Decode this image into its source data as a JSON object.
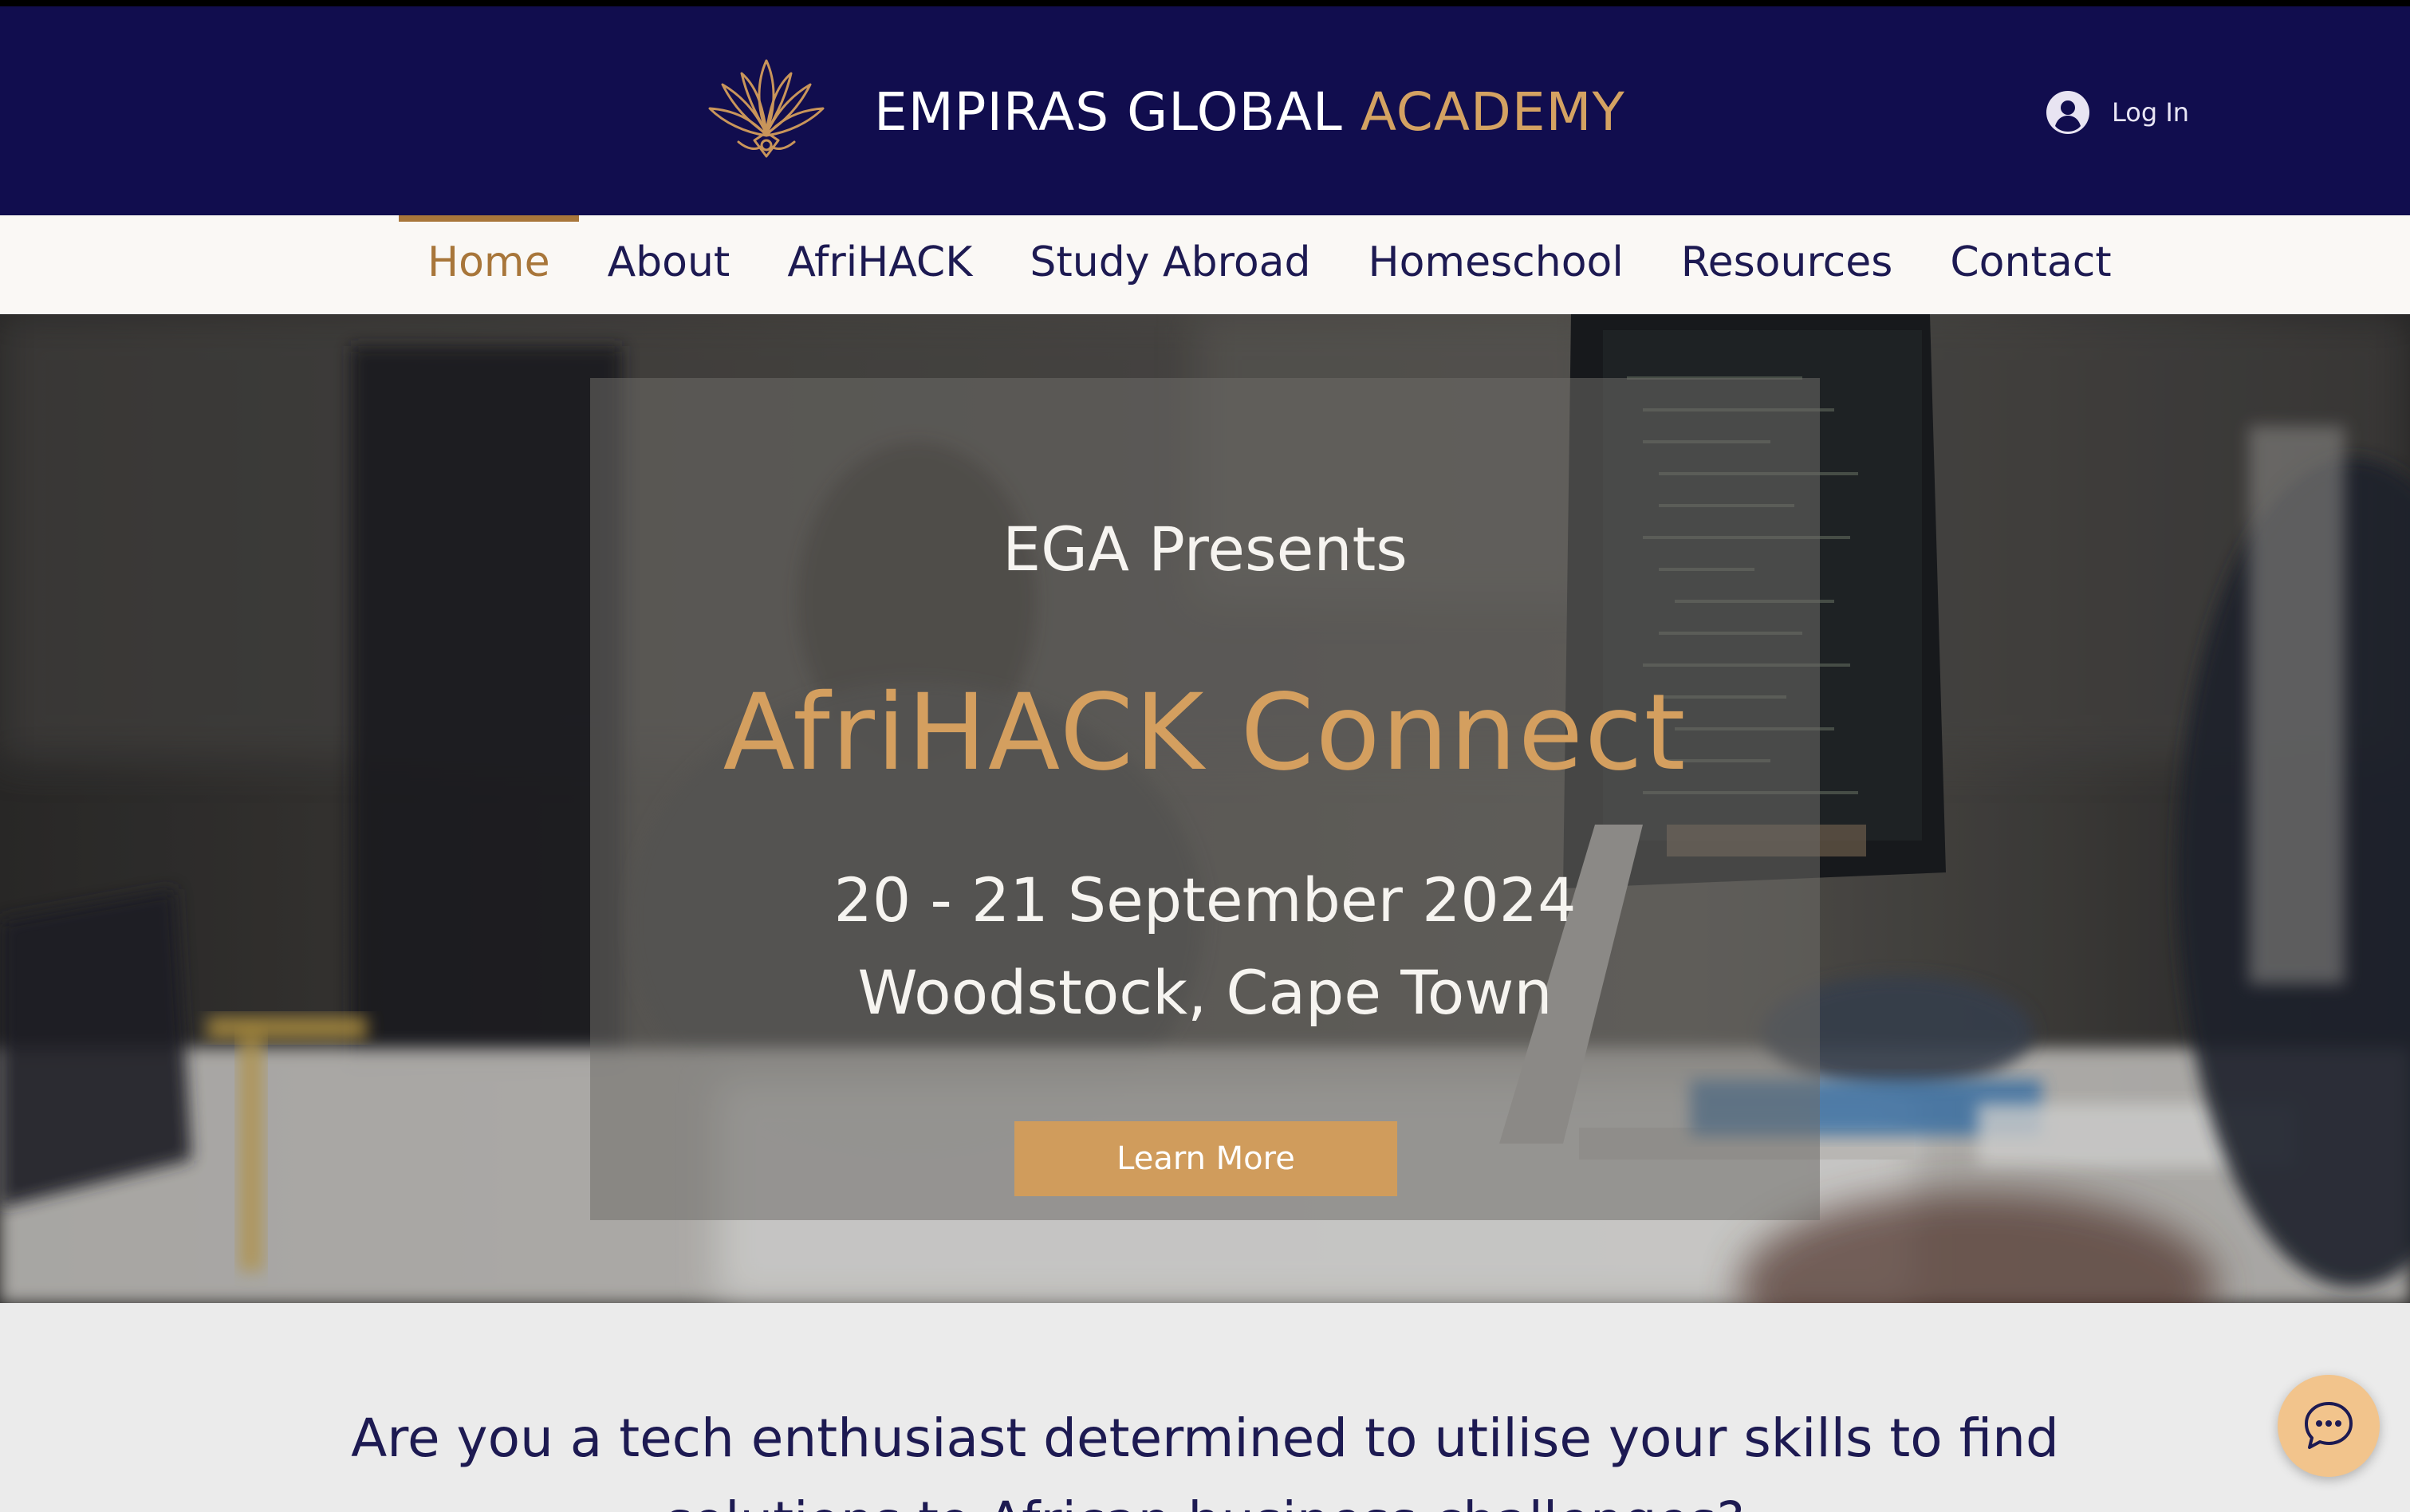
{
  "header": {
    "brand_part1": "EMPIRAS GLOBAL",
    "brand_part2": "ACADEMY",
    "logo_icon": "lotus-logo-icon",
    "login_label": "Log In",
    "login_icon": "user-avatar-icon"
  },
  "nav": {
    "items": [
      {
        "label": "Home",
        "active": true
      },
      {
        "label": "About"
      },
      {
        "label": "AfriHACK"
      },
      {
        "label": "Study Abroad"
      },
      {
        "label": "Homeschool"
      },
      {
        "label": "Resources"
      },
      {
        "label": "Contact"
      }
    ]
  },
  "hero": {
    "eyebrow": "EGA Presents",
    "title": "AfriHACK Connect",
    "date": "20  - 21 September 2024",
    "location": "Woodstock, Cape Town",
    "button_label": "Learn More"
  },
  "intro": {
    "text": "Are you a tech enthusiast determined to utilise your skills to find solutions to African business challenges?"
  },
  "chat": {
    "icon": "chat-bubble-icon"
  },
  "colors": {
    "header_bg": "#110d4e",
    "accent_gold": "#d4a262",
    "nav_bg": "#faf8f5",
    "nav_text": "#1d1a52",
    "nav_active": "#a8763a",
    "button_bg": "#d09c5c",
    "chat_bg": "#f2c48c"
  }
}
